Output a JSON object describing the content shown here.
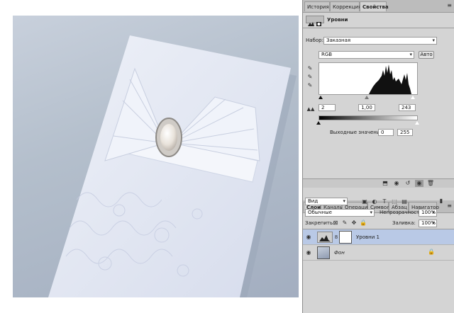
{
  "panel_top": {
    "tabs": [
      {
        "label": "История"
      },
      {
        "label": "Коррекция"
      },
      {
        "label": "Свойства"
      }
    ],
    "title": "Уровни",
    "preset_label": "Набор:",
    "preset_value": "Заказная",
    "channel_value": "RGB",
    "auto_label": "Авто",
    "input_black": "2",
    "input_gamma": "1,00",
    "input_white": "243",
    "output_label": "Выходные значения:",
    "output_black": "0",
    "output_white": "255"
  },
  "panel_layers": {
    "tabs": [
      {
        "label": "Слои"
      },
      {
        "label": "Каналы"
      },
      {
        "label": "Операции"
      },
      {
        "label": "Символ"
      },
      {
        "label": "Абзац"
      },
      {
        "label": "Навигатор"
      }
    ],
    "filter_value": "Вид",
    "blend_mode": "Обычные",
    "opacity_label": "Непрозрачность:",
    "opacity_value": "100%",
    "lock_label": "Закрепить:",
    "fill_label": "Заливка:",
    "fill_value": "100%",
    "layers": [
      {
        "name": "Уровни 1"
      },
      {
        "name": "Фон"
      }
    ]
  },
  "colors": {
    "panel_bg": "#d4d4d4",
    "layer_selected": "#b9c9e6",
    "canvas_bg": "#b4bfcc"
  }
}
